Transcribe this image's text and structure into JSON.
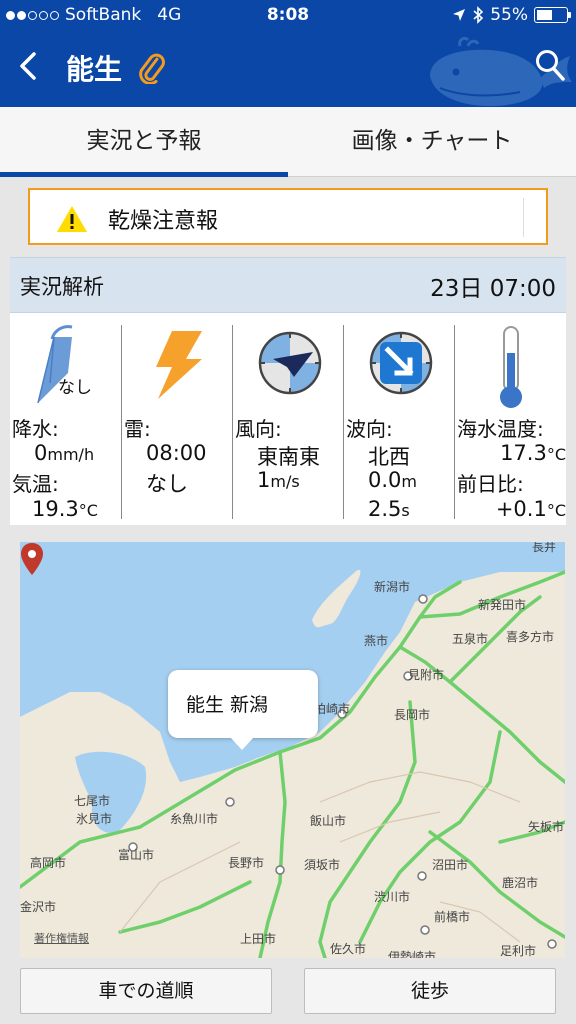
{
  "status_bar": {
    "carrier": "SoftBank",
    "network": "4G",
    "time": "8:08",
    "battery": "55%",
    "battery_level": 0.55,
    "signal_bars": 2
  },
  "nav": {
    "title": "能生",
    "back_icon": "chevron-left-icon",
    "clip_icon": "paperclip-icon",
    "search_icon": "search-icon"
  },
  "tabs": [
    {
      "label": "実況と予報",
      "active": true
    },
    {
      "label": "画像・チャート",
      "active": false
    }
  ],
  "warning": {
    "text": "乾燥注意報",
    "icon": "warning-triangle-icon"
  },
  "analysis": {
    "title": "実況解析",
    "datetime": "23日 07:00",
    "precip": {
      "icon_label": "なし",
      "label": "降水:",
      "value": "0",
      "unit": "mm/h",
      "temp_label": "気温:",
      "temp_value": "19.3",
      "temp_unit": "°C"
    },
    "thunder": {
      "label": "雷:",
      "time": "08:00",
      "value": "なし"
    },
    "wind": {
      "label": "風向:",
      "direction": "東南東",
      "speed": "1",
      "speed_unit": "m/s"
    },
    "wave": {
      "label": "波向:",
      "direction": "北西",
      "height": "0.0",
      "height_unit": "m",
      "period": "2.5",
      "period_unit": "s"
    },
    "sea_temp": {
      "label": "海水温度:",
      "value": "17.3",
      "unit": "°C",
      "diff_label": "前日比:",
      "diff_value": "+0.1",
      "diff_unit": "°C"
    }
  },
  "map": {
    "popup": "能生 新潟",
    "copyright": "著作権情報",
    "cities": [
      "長井",
      "新潟市",
      "新発田市",
      "燕市",
      "五泉市",
      "喜多方市",
      "見附市",
      "柏崎市",
      "長岡市",
      "七尾市",
      "糸魚川市",
      "氷見市",
      "飯山市",
      "矢板市",
      "高岡市",
      "富山市",
      "長野市",
      "須坂市",
      "沼田市",
      "渋川市",
      "鹿沼市",
      "金沢市",
      "上田市",
      "前橋市",
      "佐久市",
      "伊勢崎市",
      "足利市"
    ]
  },
  "buttons": {
    "car_route": "車での道順",
    "walk": "徒歩"
  }
}
